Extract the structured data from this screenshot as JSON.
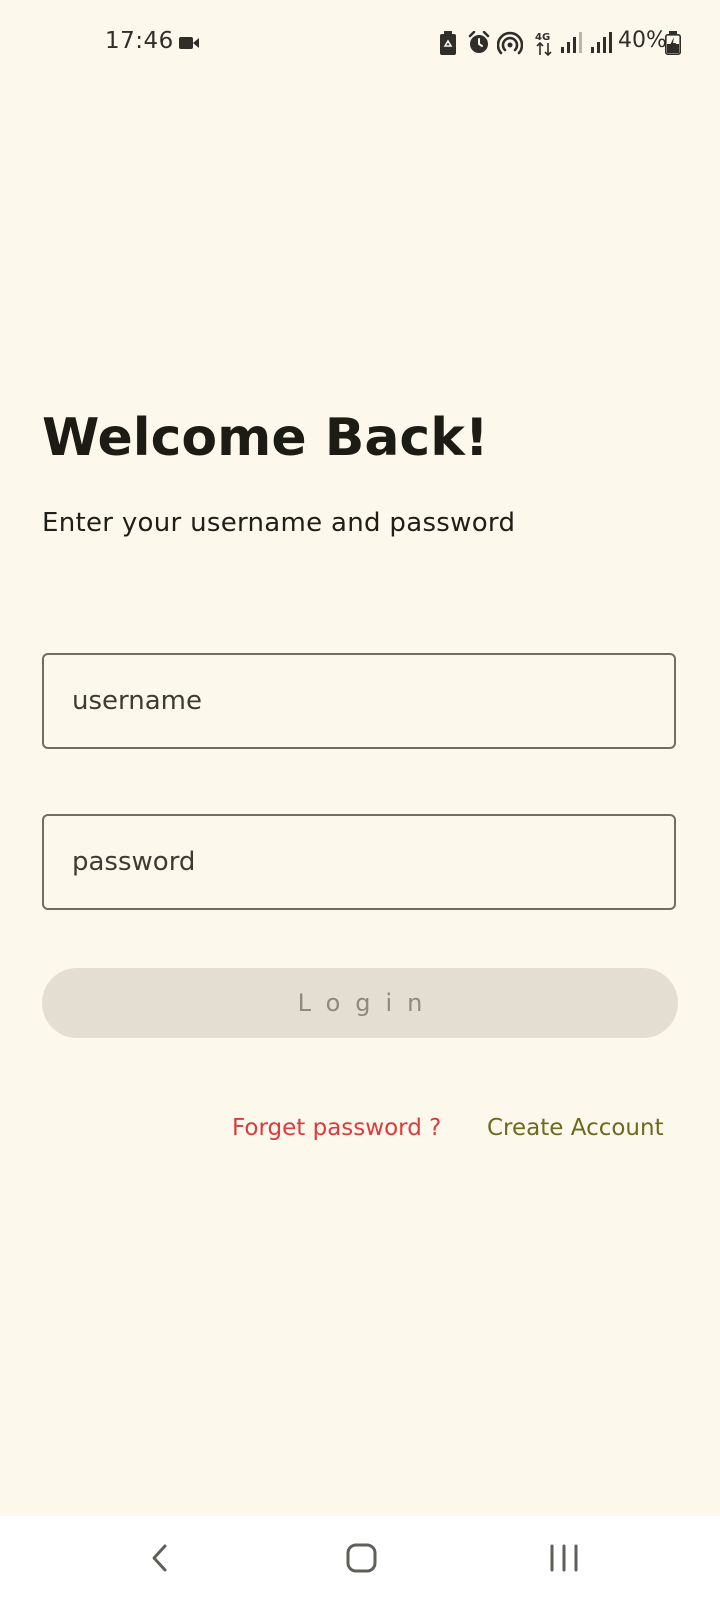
{
  "status_bar": {
    "time": "17:46",
    "battery_percent": "40%",
    "icons": [
      "video-camera-icon",
      "battery-saver-icon",
      "alarm-icon",
      "hotspot-icon",
      "4g-data-icon",
      "signal-sim1-icon",
      "signal-sim2-icon",
      "battery-charging-icon"
    ]
  },
  "login": {
    "title": "Welcome Back!",
    "subtitle": "Enter your username and password",
    "username": {
      "value": "",
      "placeholder": "username"
    },
    "password": {
      "value": "",
      "placeholder": "password"
    },
    "login_label": "Login",
    "forgot_label": "Forget password ?",
    "create_label": "Create Account"
  },
  "colors": {
    "background": "#fdf8ec",
    "text": "#1c1b14",
    "button_bg": "#e4ded2",
    "button_text": "#8d8a80",
    "forgot_link": "#e0393c",
    "create_link": "#6c6a1e",
    "field_border": "#6f6e62"
  },
  "nav_bar": {
    "icons": [
      "back-icon",
      "home-icon",
      "recents-icon"
    ]
  }
}
